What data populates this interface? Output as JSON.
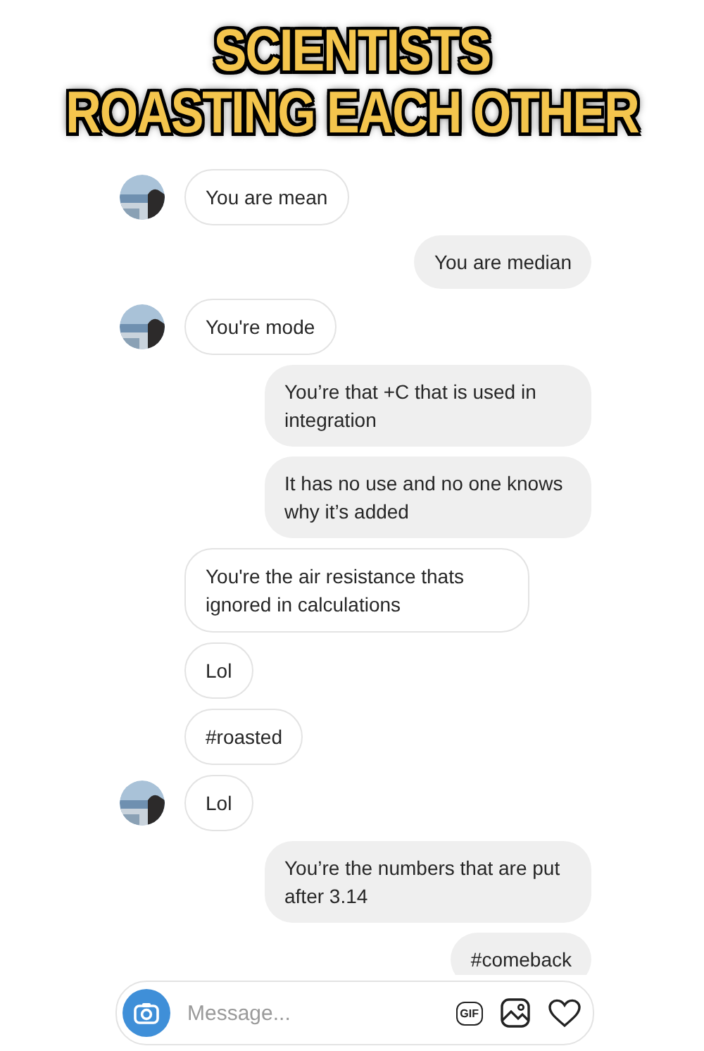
{
  "caption": {
    "lines": [
      "SCIENTISTS",
      "ROASTING EACH OTHER"
    ]
  },
  "messages": [
    {
      "kind": "received",
      "avatar": true,
      "text": "You are mean"
    },
    {
      "kind": "sent",
      "text": "You are median"
    },
    {
      "kind": "received",
      "avatar": true,
      "text": "You're mode"
    },
    {
      "kind": "sent",
      "text": "You’re that +C that is used in integration"
    },
    {
      "kind": "sent",
      "text": "It has no use and no one knows why it’s added"
    },
    {
      "kind": "received",
      "avatar": false,
      "text": "You're the air resistance thats ignored in calculations"
    },
    {
      "kind": "received",
      "avatar": false,
      "text": "Lol"
    },
    {
      "kind": "received",
      "avatar": false,
      "text": "#roasted"
    },
    {
      "kind": "received",
      "avatar": true,
      "text": "Lol"
    },
    {
      "kind": "sent",
      "text": "You’re the numbers that are put after 3.14"
    },
    {
      "kind": "sent",
      "text": "#comeback"
    }
  ],
  "composer": {
    "placeholder": "Message...",
    "gif_label": "GIF"
  }
}
